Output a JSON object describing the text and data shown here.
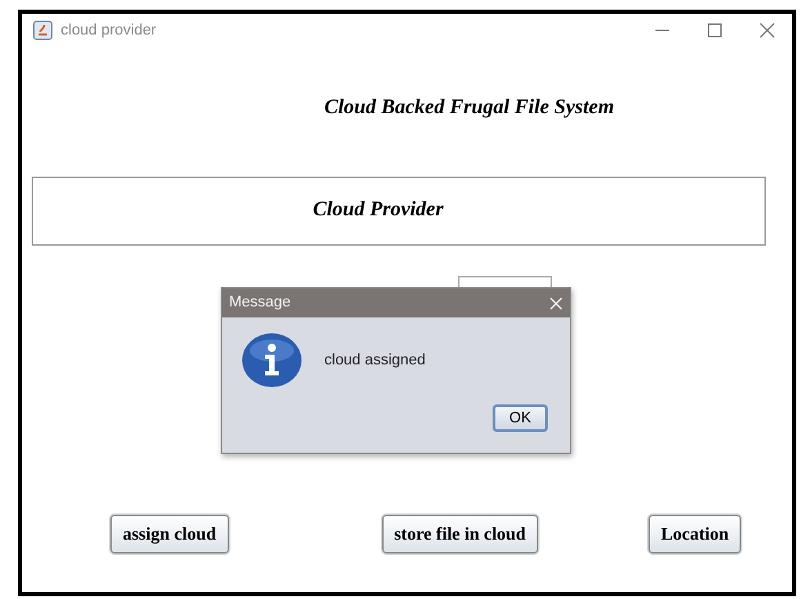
{
  "window": {
    "title": "cloud provider"
  },
  "heading": "Cloud Backed Frugal File System",
  "panel": {
    "title": "Cloud Provider"
  },
  "buttons": [
    "assign cloud",
    "store file in cloud",
    "Location"
  ],
  "dialog": {
    "title": "Message",
    "message": "cloud assigned",
    "button": "OK"
  }
}
